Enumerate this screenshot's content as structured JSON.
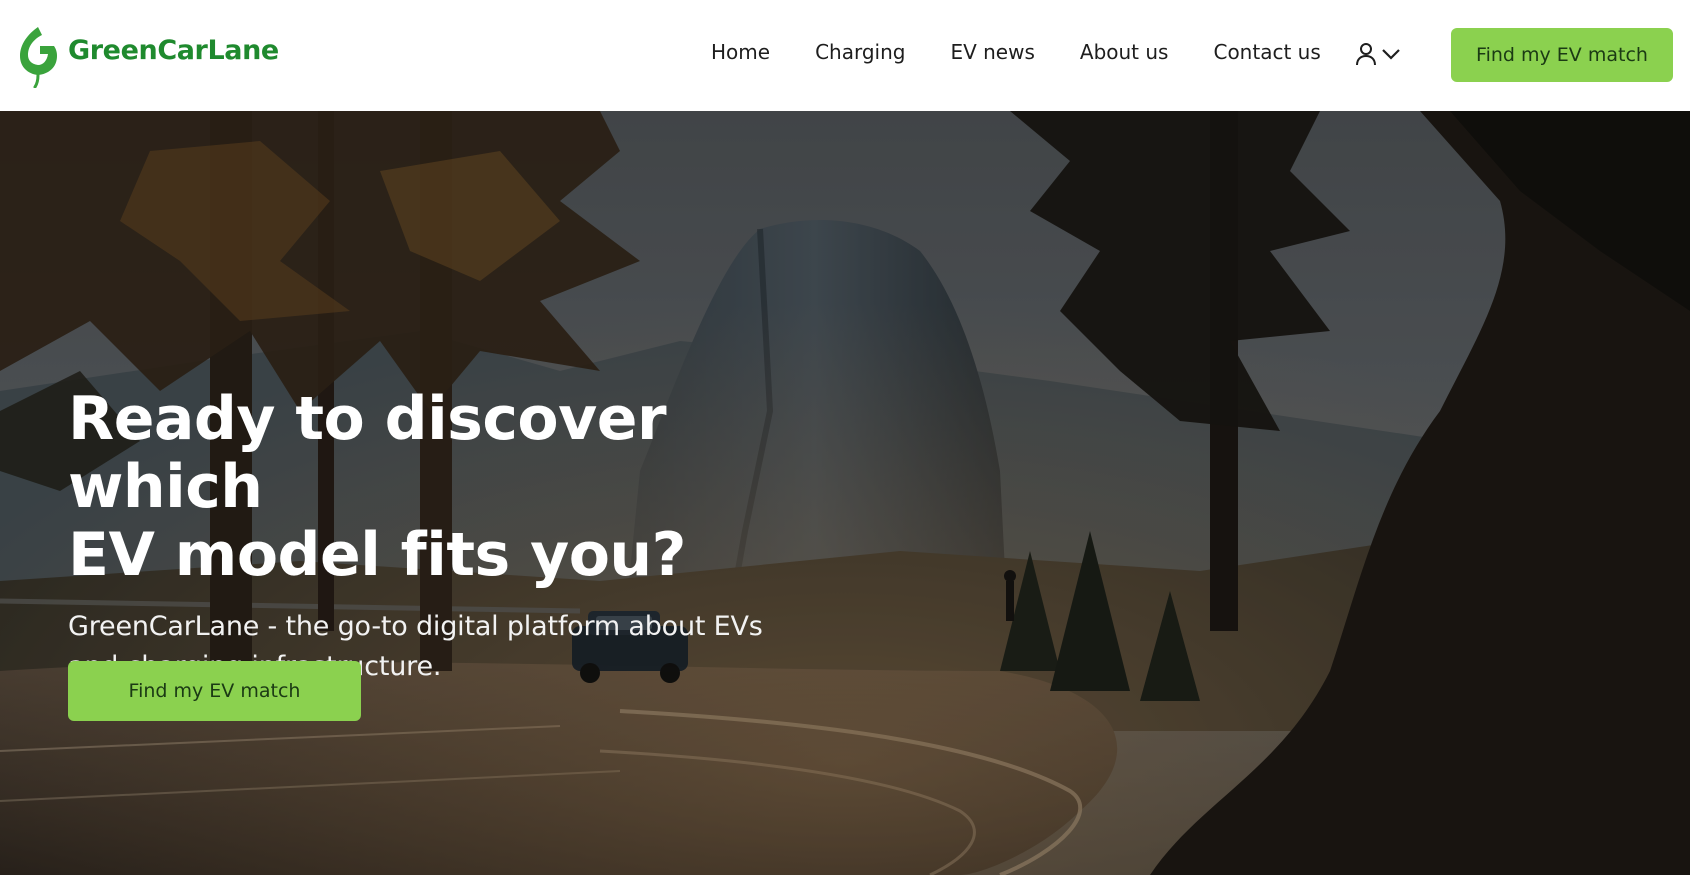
{
  "brand": {
    "name": "GreenCarLane",
    "logo_icon": "leaf-g-logo-icon",
    "color": "#1f8a2e"
  },
  "nav": {
    "items": [
      {
        "label": "Home"
      },
      {
        "label": "Charging"
      },
      {
        "label": "EV news"
      },
      {
        "label": "About us"
      },
      {
        "label": "Contact us"
      }
    ],
    "account_icon": "user-icon",
    "account_dropdown_icon": "chevron-down-icon",
    "cta_label": "Find my EV match"
  },
  "hero": {
    "title_line1": "Ready to discover which",
    "title_line2": "EV model fits you?",
    "subtitle": "GreenCarLane - the go-to digital platform about EVs and charging infrastructure.",
    "cta_label": "Find my EV match",
    "background": "forest-mountain-road-photo"
  },
  "colors": {
    "accent": "#8bd14f",
    "cta_text": "#1b3a14"
  }
}
